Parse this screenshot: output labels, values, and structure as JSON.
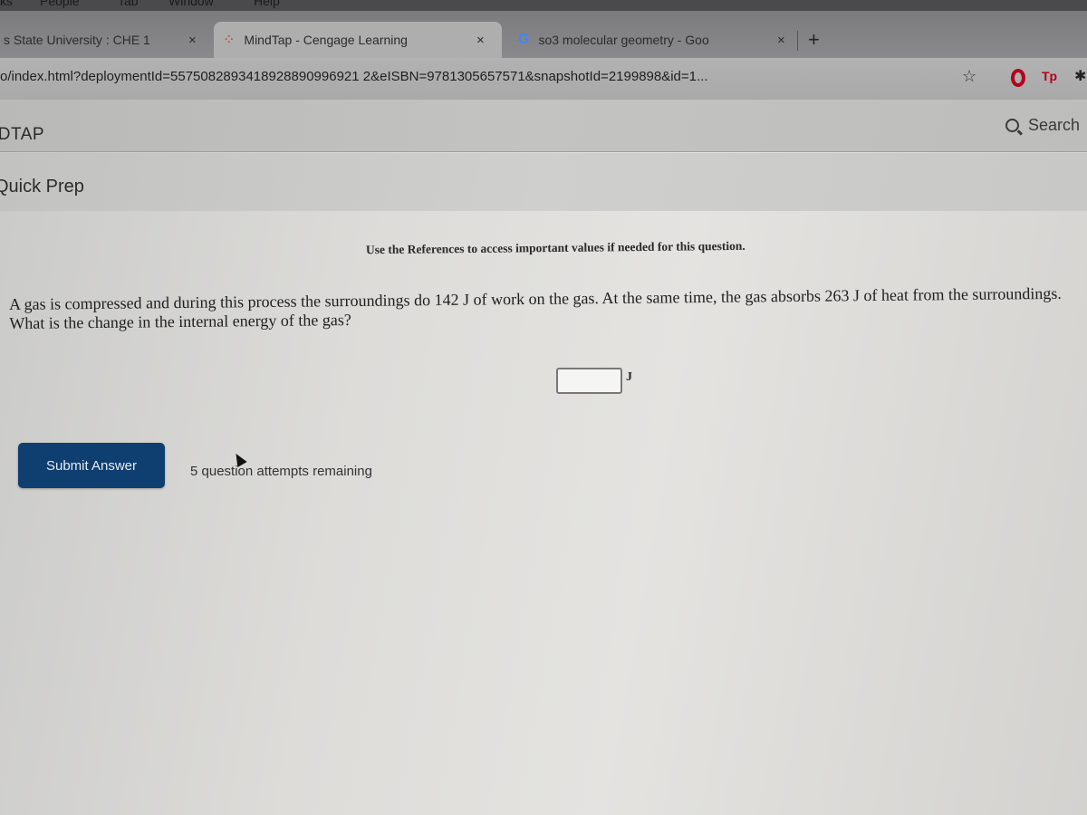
{
  "menubar": {
    "items": [
      "ks",
      "People",
      "Tab",
      "Window",
      "Help"
    ]
  },
  "tabs": [
    {
      "label": "s State University : CHE 1",
      "close": "×",
      "icon": "none",
      "active": false
    },
    {
      "label": "MindTap - Cengage Learning",
      "close": "×",
      "icon": "mindtap-logo-icon",
      "active": true
    },
    {
      "label": "so3 molecular geometry - Goo",
      "close": "×",
      "icon": "google-g-icon",
      "active": false
    }
  ],
  "new_tab_label": "+",
  "omnibox": {
    "url": "o/index.html?deploymentId=5575082893418928890996921 2&eISBN=9781305657571&snapshotId=2199898&id=1...",
    "bookmark_icon": "☆",
    "extensions": [
      "opera-icon",
      "tp-icon",
      "puzzle-icon"
    ],
    "tp_label": "Tp"
  },
  "app": {
    "brand": "IDTAP",
    "search_label": "Search",
    "section": "Quick Prep"
  },
  "question": {
    "references_note": "Use the References to access important values if needed for this question.",
    "text": "A gas is compressed and during this process the surroundings do 142 J of work on the gas. At the same time, the gas absorbs 263 J of heat from the surroundings. What is the change in the internal energy of the gas?",
    "answer_value": "",
    "unit": "J",
    "submit_label": "Submit Answer",
    "attempts_text": "5 question attempts remaining"
  },
  "colors": {
    "submit_bg": "#0f3e70",
    "extension_red": "#b3001b"
  }
}
